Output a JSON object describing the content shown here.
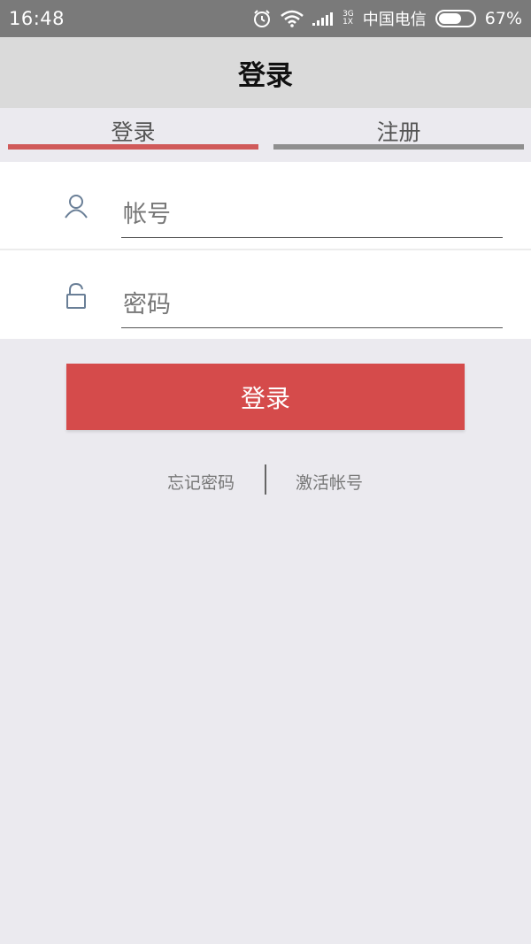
{
  "status_bar": {
    "time": "16:48",
    "network_type_top": "3G",
    "network_type_bottom": "1X",
    "carrier": "中国电信",
    "battery_percent": "67%",
    "battery_level": 0.67
  },
  "header": {
    "title": "登录"
  },
  "tabs": [
    {
      "label": "登录",
      "active": true,
      "underline_color": "#d05a5a"
    },
    {
      "label": "注册",
      "active": false,
      "underline_color": "#8f8f8f"
    }
  ],
  "form": {
    "account": {
      "placeholder": "帐号",
      "value": ""
    },
    "password": {
      "placeholder": "密码",
      "value": ""
    }
  },
  "actions": {
    "login_label": "登录",
    "forgot_password_label": "忘记密码",
    "activate_account_label": "激活帐号"
  },
  "colors": {
    "accent": "#d54b4b",
    "page_background": "#ebeaef",
    "title_bar": "#dadada"
  },
  "icons": {
    "account": "user-icon",
    "password": "unlock-icon"
  }
}
